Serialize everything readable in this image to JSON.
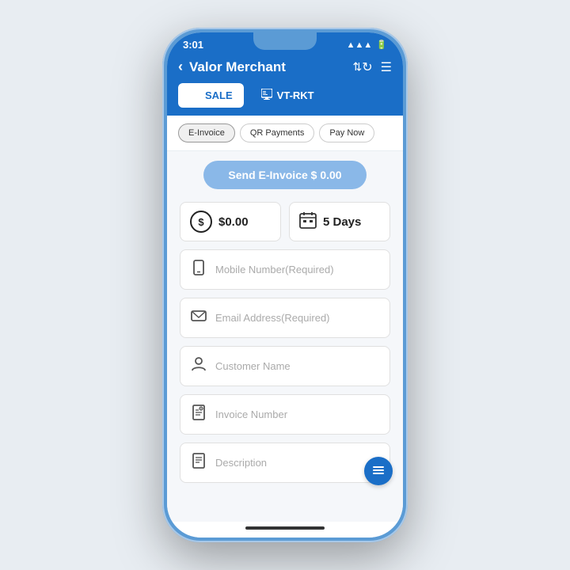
{
  "status_bar": {
    "time": "3:01",
    "wifi_icon": "wifi",
    "battery_icon": "battery"
  },
  "header": {
    "back_label": "‹",
    "title": "Valor Merchant",
    "transfer_icon": "⇅",
    "refresh_icon": "↻",
    "menu_icon": "☰"
  },
  "tabs": [
    {
      "id": "sale",
      "label": "SALE",
      "icon": "list",
      "active": true
    },
    {
      "id": "vt-rkt",
      "label": "VT-RKT",
      "icon": "terminal",
      "active": false
    }
  ],
  "sub_tabs": [
    {
      "label": "E-Invoice",
      "active": true
    },
    {
      "label": "QR Payments",
      "active": false
    },
    {
      "label": "Pay Now",
      "active": false
    }
  ],
  "send_button": {
    "label": "Send E-Invoice $ 0.00"
  },
  "amount_box": {
    "icon": "$",
    "value": "$0.00"
  },
  "days_box": {
    "value": "5 Days"
  },
  "fields": [
    {
      "id": "mobile",
      "placeholder": "Mobile Number(Required)",
      "icon_type": "phone"
    },
    {
      "id": "email",
      "placeholder": "Email Address(Required)",
      "icon_type": "email"
    },
    {
      "id": "customer",
      "placeholder": "Customer Name",
      "icon_type": "person"
    },
    {
      "id": "invoice",
      "placeholder": "Invoice Number",
      "icon_type": "invoice"
    },
    {
      "id": "description",
      "placeholder": "Description",
      "icon_type": "desc"
    }
  ],
  "fab": {
    "icon": "≡"
  }
}
